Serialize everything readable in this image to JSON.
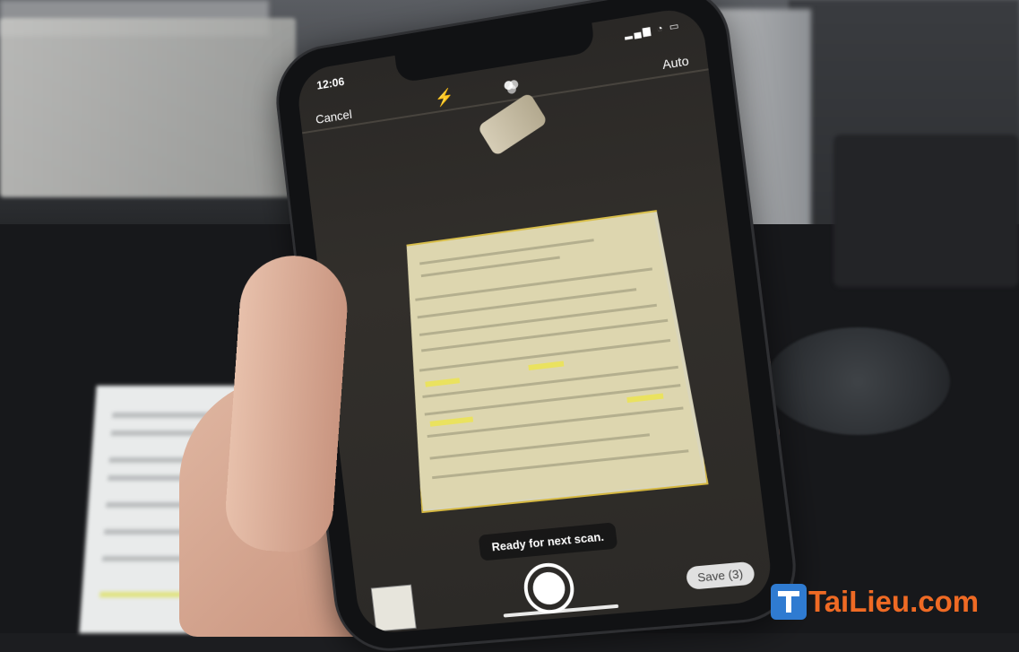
{
  "status_bar": {
    "time": "12:06",
    "indicators": "▂▄▆ ◔ ▭"
  },
  "scanner_top": {
    "cancel_label": "Cancel",
    "flash_icon": "flash-icon",
    "filter_icon": "color-filter-icon",
    "auto_label": "Auto"
  },
  "scanner_bottom": {
    "status_message": "Ready for next scan.",
    "save_label": "Save (3)"
  },
  "watermark": {
    "text": "TaiLieu.com"
  },
  "colors": {
    "watermark_orange": "#ef6a24",
    "watermark_blue": "#2f7bd1",
    "doc_highlight": "#e9e35a",
    "doc_outline": "#d4b740"
  }
}
